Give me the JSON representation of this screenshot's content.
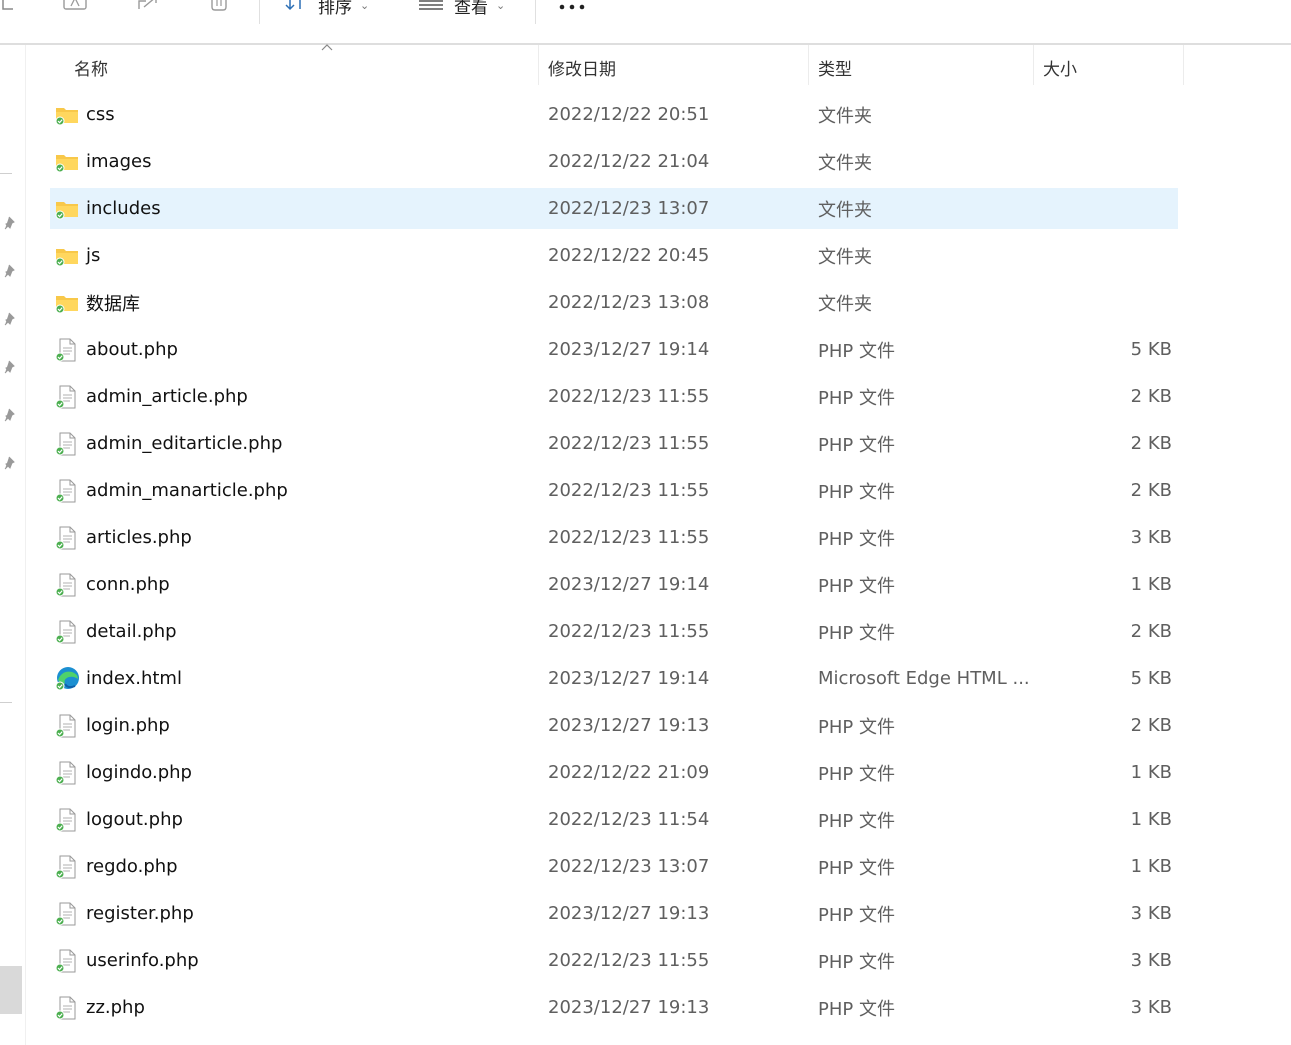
{
  "toolbar": {
    "sort_label": "排序",
    "view_label": "查看"
  },
  "columns": {
    "name": "名称",
    "modified": "修改日期",
    "type": "类型",
    "size": "大小"
  },
  "files": [
    {
      "name": "css",
      "modified": "2022/12/22 20:51",
      "type": "文件夹",
      "size": "",
      "icon": "folder-icon"
    },
    {
      "name": "images",
      "modified": "2022/12/22 21:04",
      "type": "文件夹",
      "size": "",
      "icon": "folder-icon"
    },
    {
      "name": "includes",
      "modified": "2022/12/23 13:07",
      "type": "文件夹",
      "size": "",
      "icon": "folder-icon",
      "selected": true
    },
    {
      "name": "js",
      "modified": "2022/12/22 20:45",
      "type": "文件夹",
      "size": "",
      "icon": "folder-icon"
    },
    {
      "name": "数据库",
      "modified": "2022/12/23 13:08",
      "type": "文件夹",
      "size": "",
      "icon": "folder-icon"
    },
    {
      "name": "about.php",
      "modified": "2023/12/27 19:14",
      "type": "PHP 文件",
      "size": "5 KB",
      "icon": "php-file-icon"
    },
    {
      "name": "admin_article.php",
      "modified": "2022/12/23 11:55",
      "type": "PHP 文件",
      "size": "2 KB",
      "icon": "php-file-icon"
    },
    {
      "name": "admin_editarticle.php",
      "modified": "2022/12/23 11:55",
      "type": "PHP 文件",
      "size": "2 KB",
      "icon": "php-file-icon"
    },
    {
      "name": "admin_manarticle.php",
      "modified": "2022/12/23 11:55",
      "type": "PHP 文件",
      "size": "2 KB",
      "icon": "php-file-icon"
    },
    {
      "name": "articles.php",
      "modified": "2022/12/23 11:55",
      "type": "PHP 文件",
      "size": "3 KB",
      "icon": "php-file-icon"
    },
    {
      "name": "conn.php",
      "modified": "2023/12/27 19:14",
      "type": "PHP 文件",
      "size": "1 KB",
      "icon": "php-file-icon"
    },
    {
      "name": "detail.php",
      "modified": "2022/12/23 11:55",
      "type": "PHP 文件",
      "size": "2 KB",
      "icon": "php-file-icon"
    },
    {
      "name": "index.html",
      "modified": "2023/12/27 19:14",
      "type": "Microsoft Edge HTML ...",
      "size": "5 KB",
      "icon": "edge-html-icon"
    },
    {
      "name": "login.php",
      "modified": "2023/12/27 19:13",
      "type": "PHP 文件",
      "size": "2 KB",
      "icon": "php-file-icon"
    },
    {
      "name": "logindo.php",
      "modified": "2022/12/22 21:09",
      "type": "PHP 文件",
      "size": "1 KB",
      "icon": "php-file-icon"
    },
    {
      "name": "logout.php",
      "modified": "2022/12/23 11:54",
      "type": "PHP 文件",
      "size": "1 KB",
      "icon": "php-file-icon"
    },
    {
      "name": "regdo.php",
      "modified": "2022/12/23 13:07",
      "type": "PHP 文件",
      "size": "1 KB",
      "icon": "php-file-icon"
    },
    {
      "name": "register.php",
      "modified": "2023/12/27 19:13",
      "type": "PHP 文件",
      "size": "3 KB",
      "icon": "php-file-icon"
    },
    {
      "name": "userinfo.php",
      "modified": "2022/12/23 11:55",
      "type": "PHP 文件",
      "size": "3 KB",
      "icon": "php-file-icon"
    },
    {
      "name": "zz.php",
      "modified": "2023/12/27 19:13",
      "type": "PHP 文件",
      "size": "3 KB",
      "icon": "php-file-icon"
    }
  ],
  "colors": {
    "selected_row": "#e5f3fd",
    "folder": "#f8c84a",
    "sync_ok": "#4caf50"
  }
}
